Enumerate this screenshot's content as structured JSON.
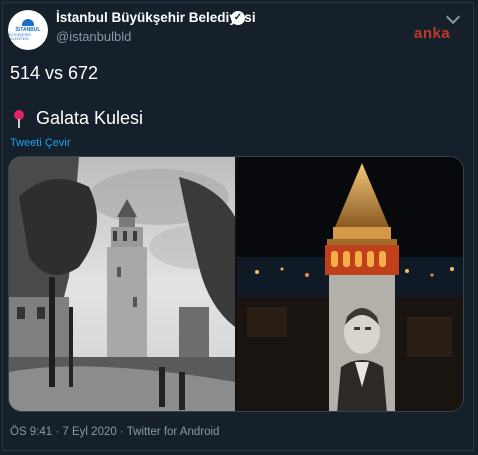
{
  "account": {
    "display_name": "İstanbul Büyükşehir Belediyesi",
    "handle": "@istanbulbld",
    "verified_glyph": "✓",
    "avatar_icon": "ibb-logo-icon",
    "avatar_text_line1": "İSTANBUL",
    "avatar_text_line2": "BÜYÜKŞEHİR BELEDİYESİ"
  },
  "watermark": "anka",
  "tweet": {
    "line1": "514 vs 672",
    "pin_icon": "round-pushpin-icon",
    "line2": "Galata Kulesi",
    "translate_link": "Tweeti Çevir"
  },
  "media": {
    "left_image": "historic-galata-tower-photo",
    "right_image": "galata-tower-night-projection-photo"
  },
  "meta": {
    "info_line": "ÖS 9:41 · 7 Eyl 2020 · Twitter for Android"
  },
  "colors": {
    "background": "#15202b",
    "secondary_text": "#8899a6",
    "link": "#1da1f2",
    "watermark": "#c0392b",
    "pin": "#e0245e"
  }
}
